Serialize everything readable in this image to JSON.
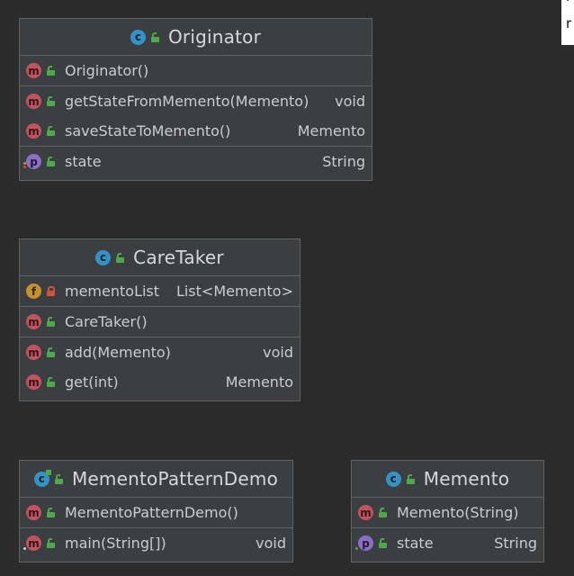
{
  "corner": {
    "line1": "r",
    "line2": "r"
  },
  "classes": {
    "originator": {
      "name": "Originator",
      "constructor": {
        "name": "Originator()",
        "type": ""
      },
      "methods": [
        {
          "name": "getStateFromMemento(Memento)",
          "type": "void"
        },
        {
          "name": "saveStateToMemento()",
          "type": "Memento"
        }
      ],
      "properties": [
        {
          "name": "state",
          "type": "String"
        }
      ]
    },
    "caretaker": {
      "name": "CareTaker",
      "fields": [
        {
          "name": "mementoList",
          "type": "List<Memento>"
        }
      ],
      "constructor": {
        "name": "CareTaker()",
        "type": ""
      },
      "methods": [
        {
          "name": "add(Memento)",
          "type": "void"
        },
        {
          "name": "get(int)",
          "type": "Memento"
        }
      ]
    },
    "demo": {
      "name": "MementoPatternDemo",
      "constructor": {
        "name": "MementoPatternDemo()",
        "type": ""
      },
      "methods": [
        {
          "name": "main(String[])",
          "type": "void"
        }
      ]
    },
    "memento": {
      "name": "Memento",
      "constructor": {
        "name": "Memento(String)",
        "type": ""
      },
      "properties": [
        {
          "name": "state",
          "type": "String"
        }
      ]
    }
  },
  "icons": {
    "class": "class-icon",
    "method": "method-icon",
    "field": "field-icon",
    "property": "property-icon",
    "public": "unlock-icon",
    "private": "lock-icon",
    "colors": {
      "class": "#3592c4",
      "method": "#c2545f",
      "field": "#c7902e",
      "property": "#8a6fc4",
      "public": "#4ea94a",
      "private": "#d0523a"
    }
  }
}
